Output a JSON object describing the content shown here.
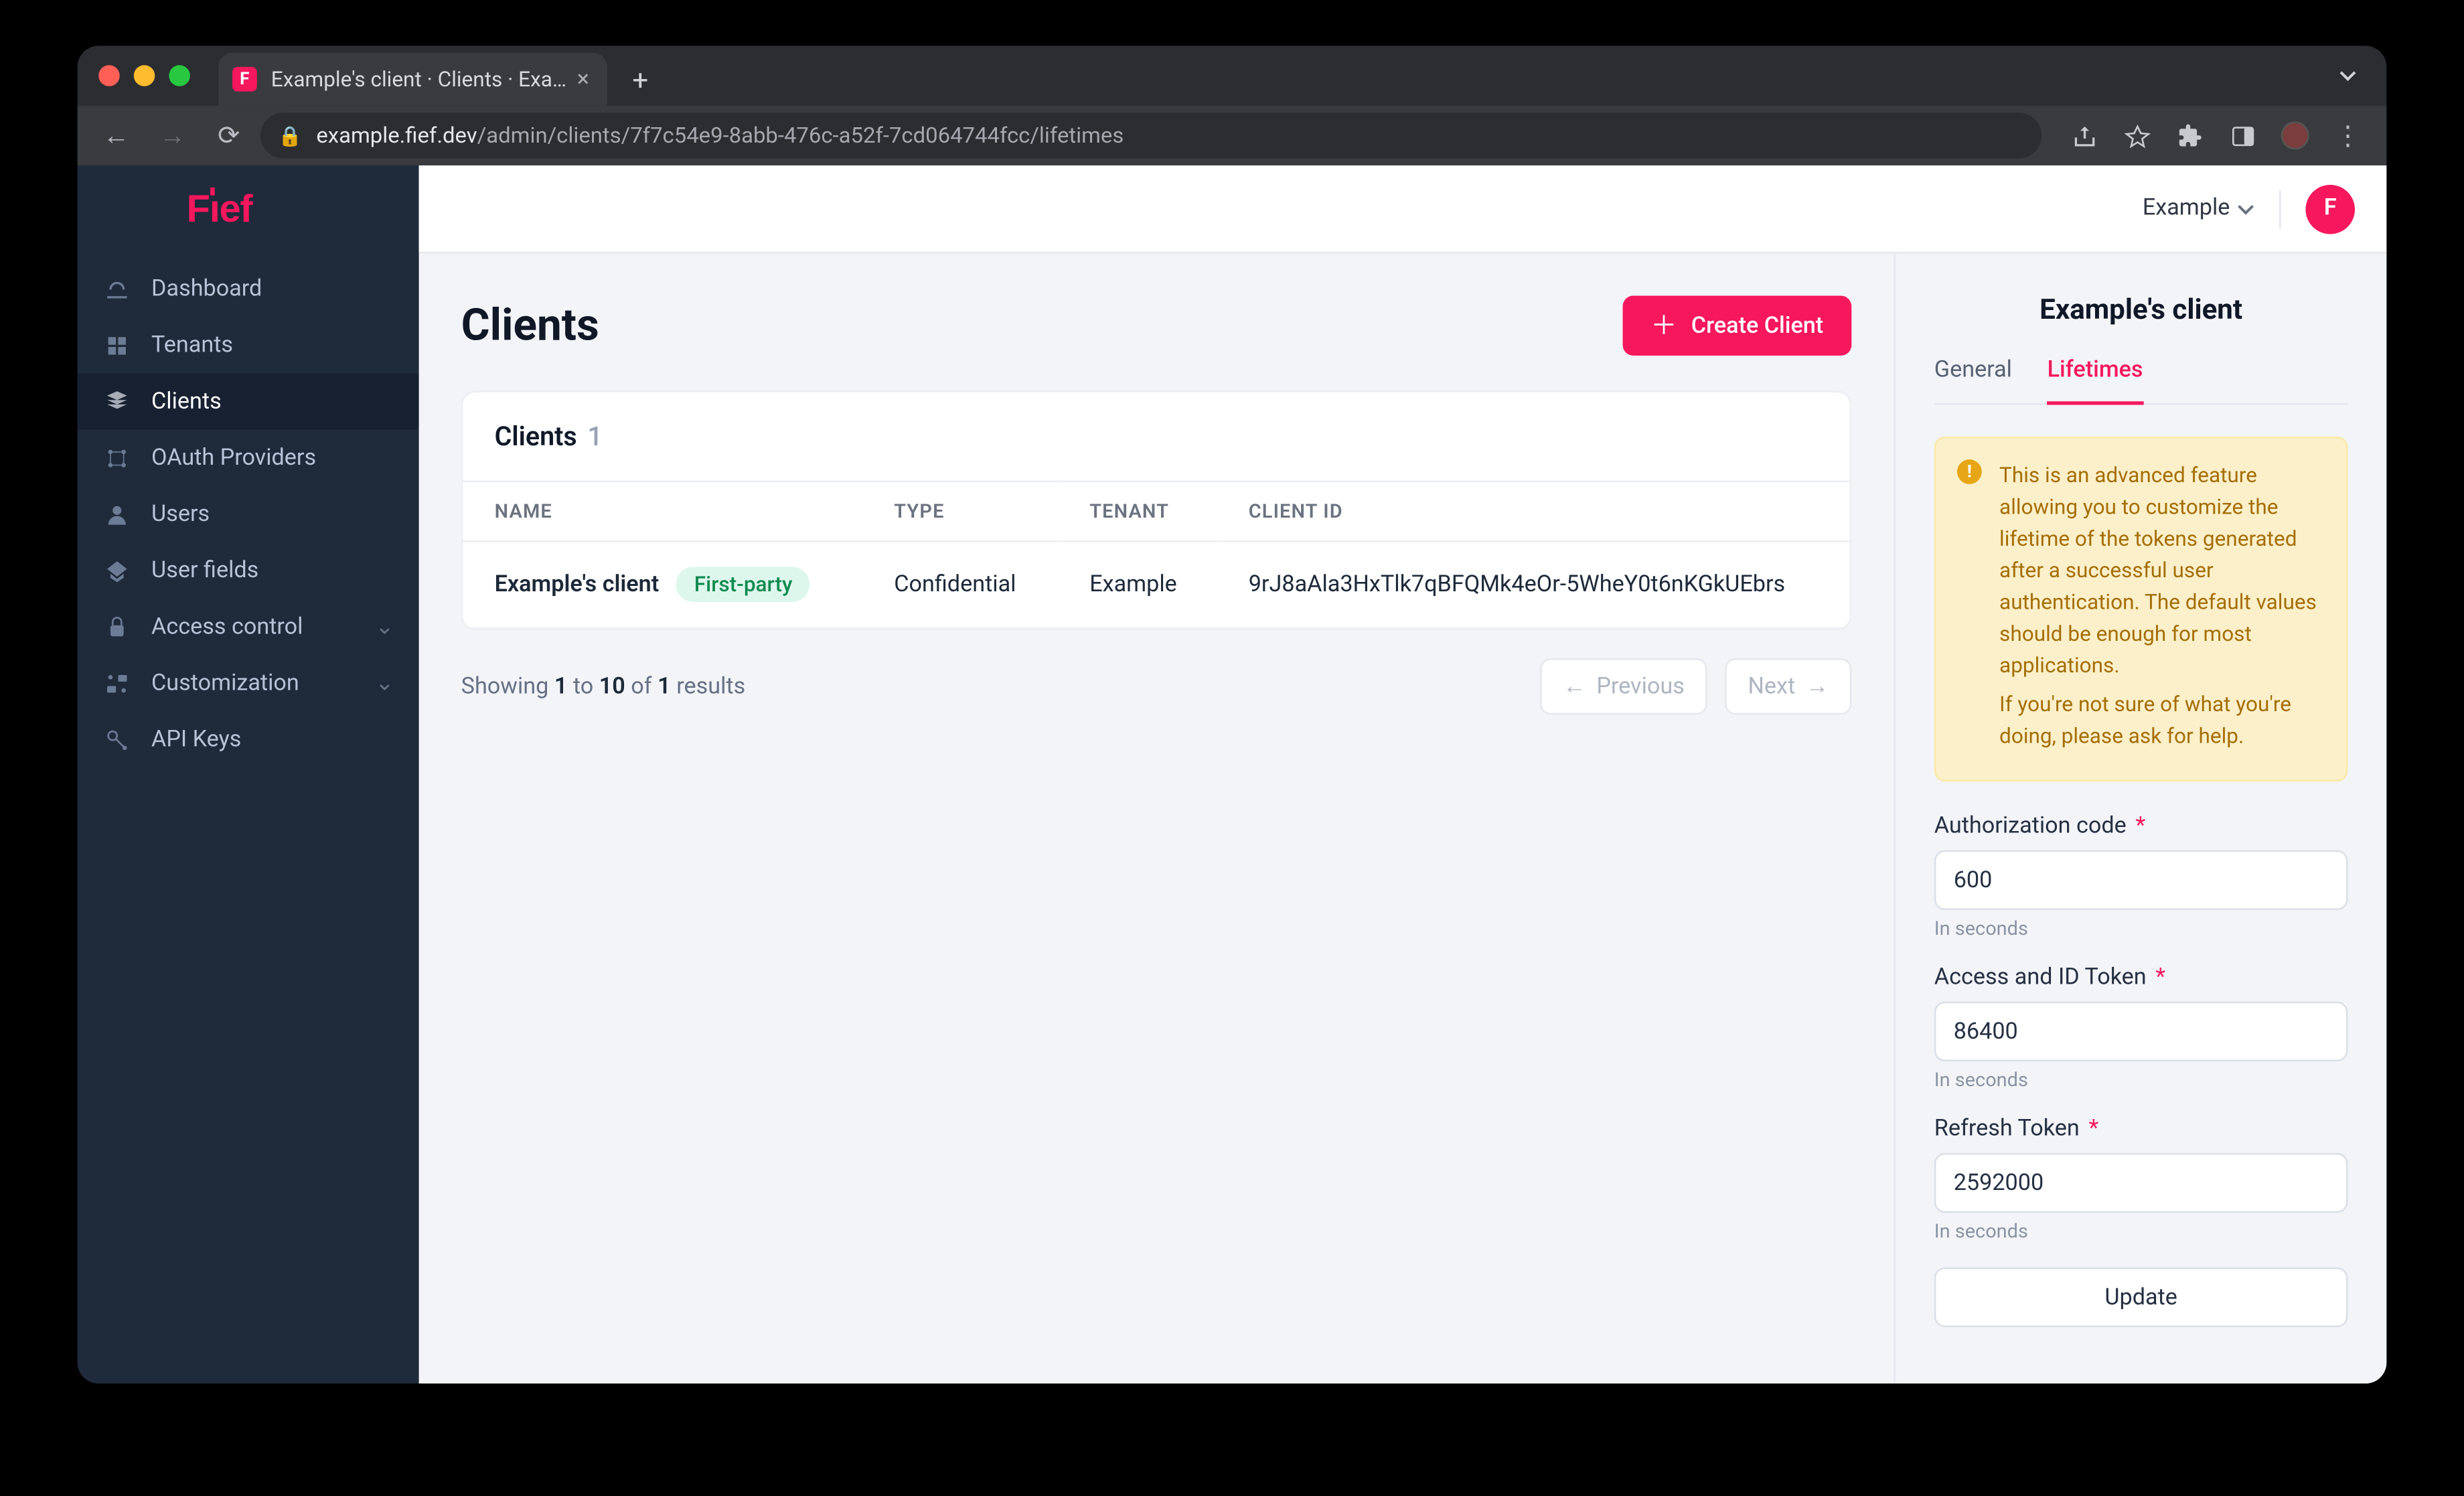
{
  "browser": {
    "tab_title": "Example's client · Clients · Exa…",
    "url_domain": "example.fief.dev",
    "url_path": "/admin/clients/7f7c54e9-8abb-476c-a52f-7cd064744fcc/lifetimes"
  },
  "sidebar": {
    "logo_text": "Fief",
    "items": [
      {
        "label": "Dashboard"
      },
      {
        "label": "Tenants"
      },
      {
        "label": "Clients"
      },
      {
        "label": "OAuth Providers"
      },
      {
        "label": "Users"
      },
      {
        "label": "User fields"
      },
      {
        "label": "Access control",
        "expandable": true
      },
      {
        "label": "Customization",
        "expandable": true
      },
      {
        "label": "API Keys"
      }
    ],
    "active_index": 2
  },
  "header": {
    "workspace_label": "Example",
    "avatar_letter": "F"
  },
  "main": {
    "title": "Clients",
    "create_button": "Create Client",
    "card_title": "Clients",
    "card_count": "1",
    "columns": [
      "NAME",
      "TYPE",
      "TENANT",
      "CLIENT ID"
    ],
    "rows": [
      {
        "name": "Example's client",
        "badge": "First-party",
        "type": "Confidential",
        "tenant": "Example",
        "client_id": "9rJ8aAla3HxTlk7qBFQMk4eOr-5WheY0t6nKGkUEbrs"
      }
    ],
    "pagination": {
      "text_prefix": "Showing",
      "from": "1",
      "to_word": "to",
      "to": "10",
      "of_word": "of",
      "total": "1",
      "text_suffix": "results",
      "prev": "Previous",
      "next": "Next"
    }
  },
  "details": {
    "title": "Example's client",
    "tabs": [
      {
        "label": "General"
      },
      {
        "label": "Lifetimes"
      }
    ],
    "active_tab": 1,
    "alert_line1": "This is an advanced feature allowing you to customize the lifetime of the tokens generated after a successful user authentication. The default values should be enough for most applications.",
    "alert_line2": "If you're not sure of what you're doing, please ask for help.",
    "fields": [
      {
        "label": "Authorization code",
        "value": "600",
        "hint": "In seconds"
      },
      {
        "label": "Access and ID Token",
        "value": "86400",
        "hint": "In seconds"
      },
      {
        "label": "Refresh Token",
        "value": "2592000",
        "hint": "In seconds"
      }
    ],
    "submit": "Update"
  }
}
